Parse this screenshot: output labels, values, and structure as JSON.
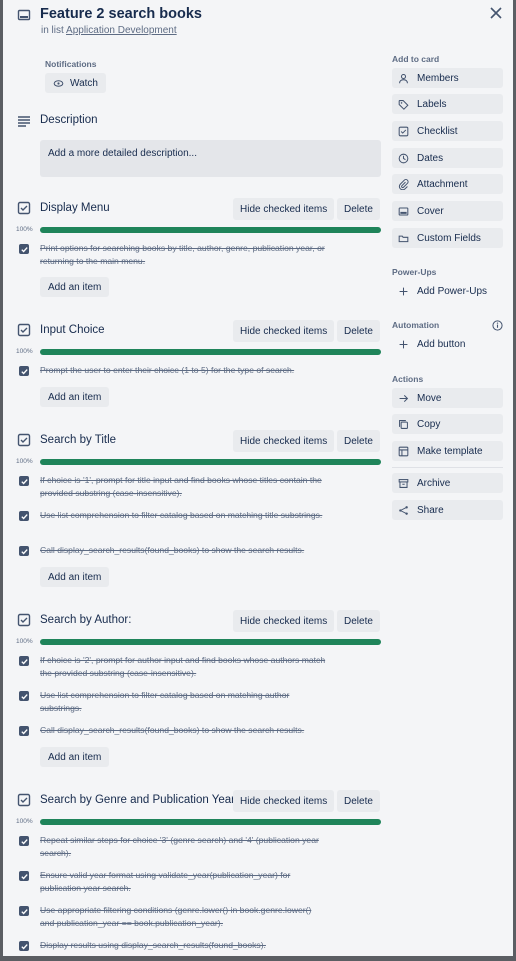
{
  "card": {
    "title": "Feature 2 search books",
    "in_list_prefix": "in list",
    "list_name": "Application Development"
  },
  "notifications": {
    "label": "Notifications",
    "watch": "Watch"
  },
  "description": {
    "heading": "Description",
    "placeholder": "Add a more detailed description..."
  },
  "sidebar": {
    "add_to_card_label": "Add to card",
    "add_to_card": [
      {
        "label": "Members",
        "icon": "person-icon"
      },
      {
        "label": "Labels",
        "icon": "tag-icon"
      },
      {
        "label": "Checklist",
        "icon": "checklist-icon"
      },
      {
        "label": "Dates",
        "icon": "clock-icon"
      },
      {
        "label": "Attachment",
        "icon": "paperclip-icon"
      },
      {
        "label": "Cover",
        "icon": "cover-icon"
      },
      {
        "label": "Custom Fields",
        "icon": "fields-icon"
      }
    ],
    "powerups_label": "Power-Ups",
    "add_powerups": "Add Power-Ups",
    "automation_label": "Automation",
    "add_button": "Add button",
    "actions_label": "Actions",
    "actions": [
      {
        "label": "Move",
        "icon": "arrow-right-icon"
      },
      {
        "label": "Copy",
        "icon": "copy-icon"
      },
      {
        "label": "Make template",
        "icon": "template-icon"
      },
      {
        "label": "Archive",
        "icon": "archive-icon"
      },
      {
        "label": "Share",
        "icon": "share-icon"
      }
    ]
  },
  "checklist_buttons": {
    "hide": "Hide checked items",
    "delete": "Delete",
    "add_item": "Add an item"
  },
  "checklists": [
    {
      "title": "Display Menu",
      "percent": "100%",
      "progress": 1.0,
      "items": [
        {
          "text": "Print options for searching books by title, author, genre, publication year, or returning to the main menu.",
          "checked": true
        }
      ]
    },
    {
      "title": "Input Choice",
      "percent": "100%",
      "progress": 1.0,
      "items": [
        {
          "text": "Prompt the user to enter their choice (1 to 5) for the type of search.",
          "checked": true
        }
      ]
    },
    {
      "title": "Search by Title",
      "percent": "100%",
      "progress": 1.0,
      "items": [
        {
          "text": "If choice is '1', prompt for title input and find books whose titles contain the provided substring (case-insensitive).",
          "checked": true
        },
        {
          "text": "Use list comprehension to filter catalog based on matching title substrings.",
          "checked": true
        },
        {
          "text": "Call display_search_results(found_books) to show the search results.",
          "checked": true
        }
      ]
    },
    {
      "title": "Search by Author:",
      "percent": "100%",
      "progress": 1.0,
      "items": [
        {
          "text": "If choice is '2', prompt for author input and find books whose authors match the provided substring (case-insensitive).",
          "checked": true
        },
        {
          "text": "Use list comprehension to filter catalog based on matching author substrings.",
          "checked": true
        },
        {
          "text": "Call display_search_results(found_books) to show the search results.",
          "checked": true
        }
      ]
    },
    {
      "title": "Search by Genre and Publication Year:",
      "percent": "100%",
      "progress": 1.0,
      "items": [
        {
          "text": "Repeat similar steps for choice '3' (genre search) and '4' (publication year search).",
          "checked": true
        },
        {
          "text": "Ensure valid year format using validate_year(publication_year) for publication year search.",
          "checked": true
        },
        {
          "text": "Use appropriate filtering conditions (genre.lower() in book.genre.lower() and publication_year == book.publication_year).",
          "checked": true
        },
        {
          "text": "Display results using display_search_results(found_books).",
          "checked": true
        }
      ]
    }
  ]
}
